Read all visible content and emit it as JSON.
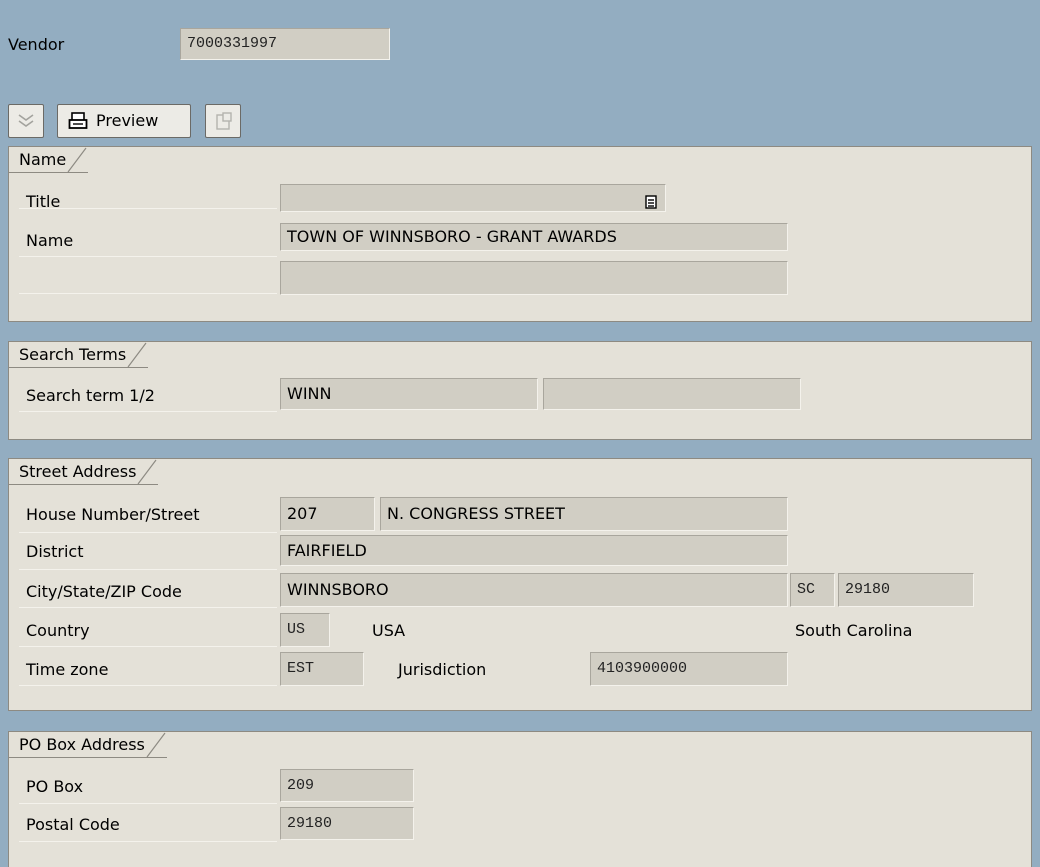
{
  "vendor": {
    "label": "Vendor",
    "value": "7000331997"
  },
  "toolbar": {
    "preview_label": "Preview"
  },
  "name_group": {
    "title": "Name",
    "title_label": "Title",
    "title_value": "",
    "name_label": "Name",
    "name_value": "TOWN OF WINNSBORO - GRANT AWARDS",
    "name2_value": ""
  },
  "search_group": {
    "title": "Search Terms",
    "label": "Search term 1/2",
    "term1": "WINN",
    "term2": ""
  },
  "street_group": {
    "title": "Street Address",
    "house_label": "House Number/Street",
    "house_number": "207",
    "street": "N. CONGRESS STREET",
    "district_label": "District",
    "district": "FAIRFIELD",
    "city_label": "City/State/ZIP Code",
    "city": "WINNSBORO",
    "state": "SC",
    "zip": "29180",
    "country_label": "Country",
    "country_code": "US",
    "country_name": "USA",
    "region_name": "South Carolina",
    "timezone_label": "Time zone",
    "timezone": "EST",
    "jurisdiction_label": "Jurisdiction",
    "jurisdiction": "4103900000"
  },
  "pobox_group": {
    "title": "PO Box Address",
    "pobox_label": "PO Box",
    "pobox": "209",
    "postal_label": "Postal Code",
    "postal_code": "29180"
  },
  "icons": [
    "collapse-icon",
    "printer-icon",
    "address-version-icon",
    "dropdown-list-icon"
  ]
}
